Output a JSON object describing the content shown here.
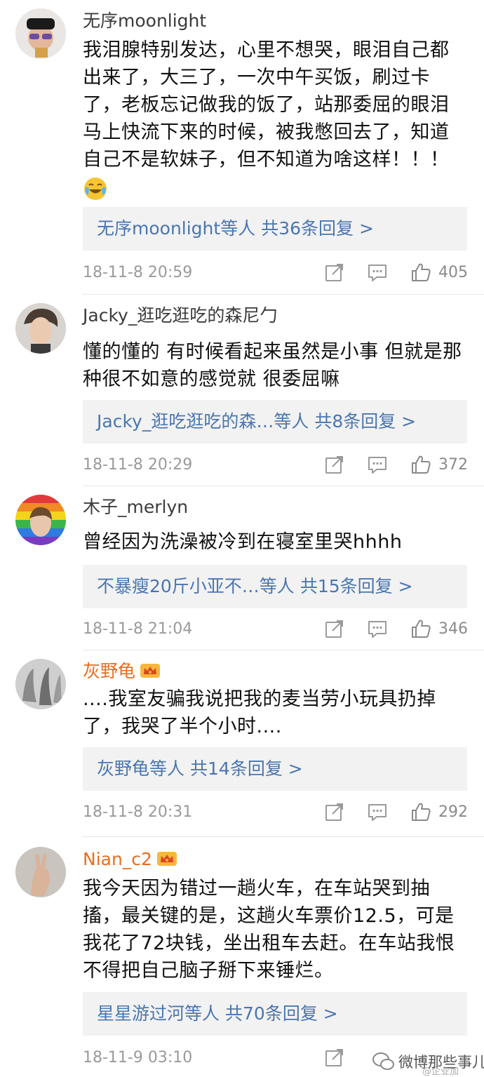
{
  "icons": {
    "share": "share-icon",
    "comment": "comment-icon",
    "like": "thumbs-up-icon",
    "emoji": "laugh-cry-emoji",
    "crown": "vip-crown-icon"
  },
  "colors": {
    "link": "#4a76b0",
    "vip_name": "#e96d1f",
    "reply_bg": "#f2f2f2"
  },
  "comments": [
    {
      "username": "无序moonlight",
      "lines": [
        "我泪腺特别发达，心里不想哭，眼泪自己都",
        "出来了，大三了，一次中午买饭，刷过卡",
        "了，老板忘记做我的饭了，站那委屈的眼泪",
        "马上快流下来的时候，被我憋回去了，知道",
        "自己不是软妹子，但不知道为啥这样！！！"
      ],
      "reply_users": "无序moonlight等人",
      "reply_count": "共36条回复 >",
      "time": "18-11-8 20:59",
      "likes": "405"
    },
    {
      "username": "Jacky_逛吃逛吃的森尼勹",
      "lines": [
        "懂的懂的 有时候看起来虽然是小事 但就是那",
        "种很不如意的感觉就 很委屈嘛"
      ],
      "reply_users": "Jacky_逛吃逛吃的森…等人",
      "reply_count": "共8条回复 >",
      "time": "18-11-8 20:29",
      "likes": "372"
    },
    {
      "username": "木子_merlyn",
      "lines": [
        "曾经因为洗澡被冷到在寝室里哭hhhh"
      ],
      "reply_users": "不暴瘦20斤小亚不…等人",
      "reply_count": "共15条回复 >",
      "time": "18-11-8 21:04",
      "likes": "346"
    },
    {
      "username": "灰野龟",
      "lines": [
        "....我室友骗我说把我的麦当劳小玩具扔掉",
        "了，我哭了半个小时...."
      ],
      "reply_users": "灰野龟等人",
      "reply_count": "共14条回复 >",
      "time": "18-11-8 20:31",
      "likes": "292"
    },
    {
      "username": "Nian_c2",
      "lines": [
        "我今天因为错过一趟火车，在车站哭到抽",
        "搐，最关键的是，这趟火车票价12.5，可是",
        "我花了72块钱，坐出租车去赶。在车站我恨",
        "不得把自己脑子掰下来锤烂。"
      ],
      "reply_users": "星星游过河等人",
      "reply_count": "共70条回复 >",
      "time": "18-11-9 03:10",
      "likes": ""
    }
  ],
  "watermark": {
    "text": "微博那些事儿",
    "sub": "@企业加"
  }
}
